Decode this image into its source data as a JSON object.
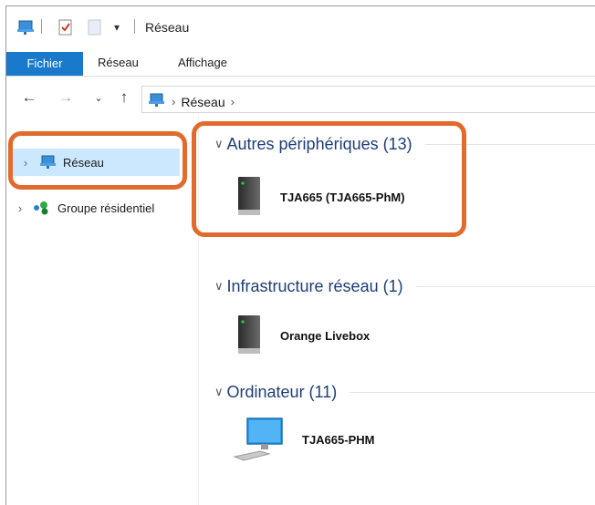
{
  "window": {
    "title": "Réseau"
  },
  "ribbon": {
    "tabs": [
      "Fichier",
      "Réseau",
      "Affichage"
    ]
  },
  "address": {
    "crumbs": [
      "Réseau"
    ]
  },
  "nav_pane": {
    "items": [
      {
        "label": "Réseau",
        "icon": "network-icon",
        "selected": true
      },
      {
        "label": "Groupe résidentiel",
        "icon": "homegroup-icon",
        "selected": false
      }
    ]
  },
  "groups": [
    {
      "header": "Autres périphériques (13)",
      "items": [
        {
          "label": "TJA665 (TJA665-PhM)",
          "icon": "device-tower-icon"
        }
      ]
    },
    {
      "header": "Infrastructure réseau (1)",
      "items": [
        {
          "label": "Orange Livebox",
          "icon": "device-tower-icon"
        }
      ]
    },
    {
      "header": "Ordinateur (11)",
      "items": [
        {
          "label": "TJA665-PHM",
          "icon": "computer-monitor-icon"
        }
      ]
    }
  ],
  "colors": {
    "accent": "#1979ca",
    "highlight": "#e26a2c",
    "selection": "#cce8ff",
    "group_header": "#1e3d78"
  }
}
